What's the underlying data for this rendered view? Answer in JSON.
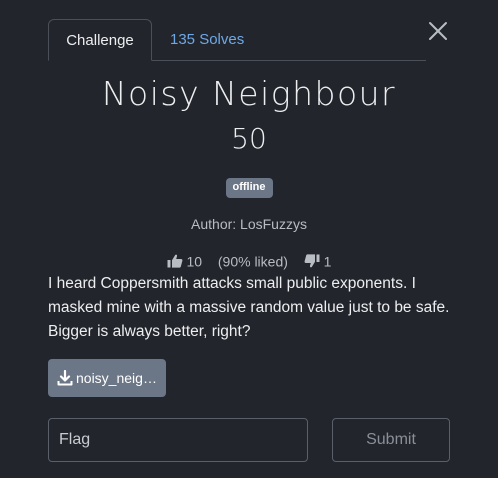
{
  "tabs": {
    "challenge_label": "Challenge",
    "solves_label": "135 Solves"
  },
  "challenge": {
    "name": "Noisy Neighbour",
    "points": "50",
    "status_badge": "offline",
    "author": "Author: LosFuzzys",
    "likes": "10",
    "liked_percent": "(90% liked)",
    "dislikes": "1",
    "description": "I heard Coppersmith attacks small public exponents. I masked mine with a massive random value just to be safe. Bigger is always better, right?",
    "file_label": "noisy_neig…"
  },
  "form": {
    "flag_placeholder": "Flag",
    "flag_value": "",
    "submit_label": "Submit"
  },
  "colors": {
    "background": "#22252b",
    "link": "#6ea8e6",
    "badge": "#6b7687",
    "border": "#4a4f58"
  },
  "icons": {
    "close": "close-icon",
    "thumbs_up": "thumbs-up-icon",
    "thumbs_down": "thumbs-down-icon",
    "download": "download-icon"
  }
}
